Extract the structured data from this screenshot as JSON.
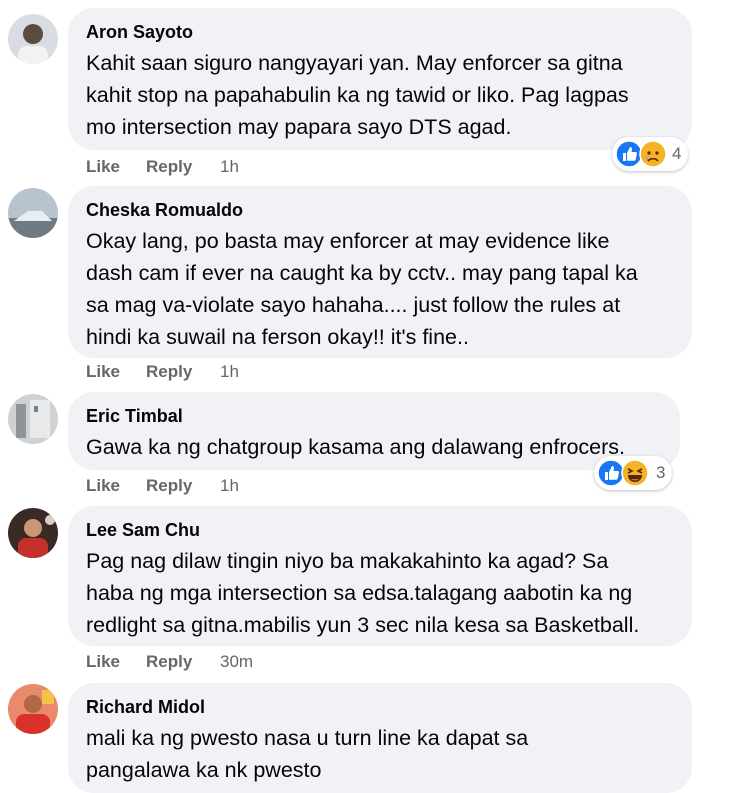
{
  "actions": {
    "like_label": "Like",
    "reply_label": "Reply"
  },
  "comments": [
    {
      "author": "Aron Sayoto",
      "text": "Kahit saan siguro nangyayari yan. May enforcer sa gitna\nkahit stop na papahabulin ka ng tawid or liko. Pag lagpas\nmo intersection may papara sayo DTS agad.",
      "time": "1h",
      "reactions": {
        "icons": [
          "like-icon",
          "sad-icon"
        ],
        "count": "4"
      }
    },
    {
      "author": "Cheska Romualdo",
      "text": "Okay lang, po basta may enforcer at may evidence like\ndash cam if ever na caught ka by cctv.. may pang tapal ka\nsa mag va-violate sayo hahaha.... just follow the rules at\nhindi ka suwail na ferson okay!! it's fine..",
      "time": "1h"
    },
    {
      "author": "Eric Timbal",
      "text": "Gawa ka ng chatgroup kasama ang dalawang enfrocers.",
      "time": "1h",
      "reactions": {
        "icons": [
          "like-icon",
          "haha-icon"
        ],
        "count": "3"
      }
    },
    {
      "author": "Lee Sam Chu",
      "text": "Pag nag dilaw tingin niyo ba makakahinto ka agad? Sa\nhaba ng mga intersection sa edsa.talagang aabotin ka ng\nredlight sa gitna.mabilis yun 3 sec nila kesa sa Basketball.",
      "time": "30m"
    },
    {
      "author": "Richard Midol",
      "text": "mali ka ng pwesto nasa u turn line ka dapat sa\npangalawa ka nk pwesto"
    }
  ],
  "colors": {
    "bubble_bg": "#f0f2f5",
    "secondary_text": "#65676b",
    "like_blue": "#1877f2",
    "reaction_yellow": "#f7b125"
  }
}
